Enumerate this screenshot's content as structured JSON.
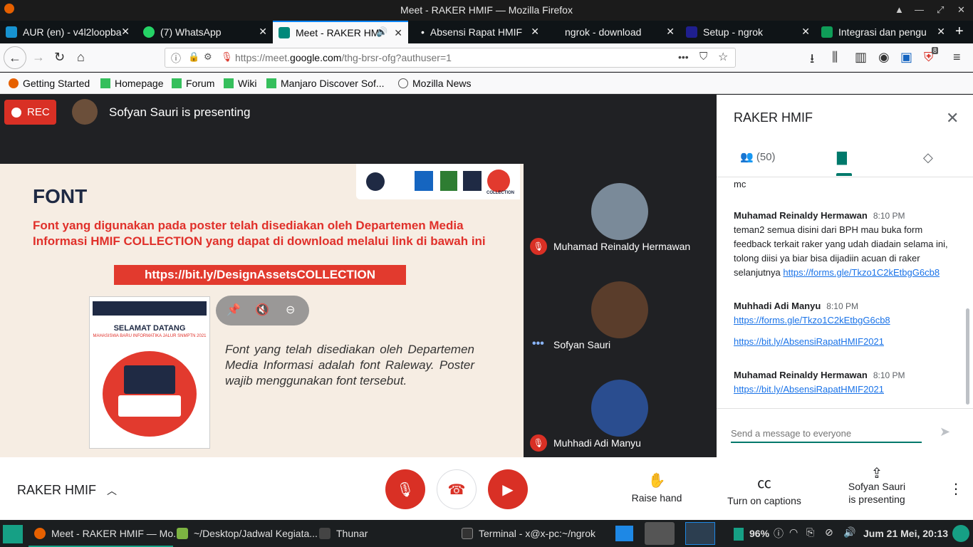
{
  "window": {
    "title": "Meet - RAKER HMIF — Mozilla Firefox"
  },
  "tabs": [
    {
      "label": "AUR (en) - v4l2loopba",
      "icon_color": "#1793d1"
    },
    {
      "label": "(7) WhatsApp",
      "icon_color": "#25d366"
    },
    {
      "label": "Meet - RAKER HMI",
      "icon_color": "#00897b",
      "active": true
    },
    {
      "label": "Absensi Rapat HMIF",
      "icon_color": "#fff"
    },
    {
      "label": "ngrok - download",
      "icon_color": "#444"
    },
    {
      "label": "Setup - ngrok",
      "icon_color": "#1f1f8f"
    },
    {
      "label": "Integrasi dan pengu",
      "icon_color": "#0f9d58"
    }
  ],
  "nav": {
    "url_prefix": "https://meet.",
    "url_domain": "google.com",
    "url_path": "/thg-brsr-ofg?authuser=1",
    "more_label": "•••",
    "badge_count": "8"
  },
  "bookmarks": [
    {
      "label": "Getting Started",
      "icon": "firefox-icon"
    },
    {
      "label": "Homepage",
      "icon": "manjaro-icon"
    },
    {
      "label": "Forum",
      "icon": "manjaro-icon"
    },
    {
      "label": "Wiki",
      "icon": "manjaro-icon"
    },
    {
      "label": "Manjaro Discover Sof...",
      "icon": "manjaro-icon"
    },
    {
      "label": "Mozilla News",
      "icon": "globe-icon"
    }
  ],
  "meet": {
    "rec_label": "REC",
    "presenting_label": "Sofyan Sauri is presenting",
    "slide": {
      "title": "FONT",
      "body": "Font yang digunakan pada poster telah disediakan oleh Departemen Media Informasi HMIF COLLECTION yang dapat di download melalui link di bawah ini",
      "link": "https://bit.ly/DesignAssetsCOLLECTION",
      "poster_title": "SELAMAT DATANG",
      "poster_subtitle": "MAHASISWA BARU INFORMATIKA JALUR SNMPTN 2021",
      "description": "Font yang telah disediakan oleh Departemen Media Informasi adalah font Raleway. Poster wajib menggunakan font tersebut.",
      "logo_collection": "COLLECTION"
    },
    "participants": [
      {
        "name": "Muhamad Reinaldy Hermawan",
        "muted": true,
        "avatar_color": "#7a8a99"
      },
      {
        "name": "Sofyan Sauri",
        "muted": false,
        "avatar_color": "#5a3d2b"
      },
      {
        "name": "Muhhadi Adi Manyu",
        "muted": true,
        "avatar_color": "#2a4d8f"
      }
    ]
  },
  "panel": {
    "title": "RAKER HMIF",
    "people_count": "(50)",
    "messages": [
      {
        "sender": "",
        "time": "",
        "lines": [
          "mc"
        ],
        "links": []
      },
      {
        "sender": "Muhamad Reinaldy Hermawan",
        "time": "8:10 PM",
        "lines": [
          "teman2 semua disini dari BPH mau buka form feedback terkait raker yang udah diadain selama ini, tolong diisi ya biar bisa dijadiin acuan di raker selanjutnya"
        ],
        "links": [
          "https://forms.gle/Tkzo1C2kEtbgG6cb8"
        ]
      },
      {
        "sender": "Muhhadi Adi Manyu",
        "time": "8:10 PM",
        "lines": [],
        "links": [
          "https://forms.gle/Tkzo1C2kEtbgG6cb8",
          "https://bit.ly/AbsensiRapatHMIF2021"
        ]
      },
      {
        "sender": "Muhamad Reinaldy Hermawan",
        "time": "8:10 PM",
        "lines": [],
        "links": [
          "https://bit.ly/AbsensiRapatHMIF2021"
        ]
      }
    ],
    "composer_placeholder": "Send a message to everyone"
  },
  "bottom": {
    "meeting_name": "RAKER HMIF",
    "raise_hand": "Raise hand",
    "captions": "Turn on captions",
    "presenting_line1": "Sofyan Sauri",
    "presenting_line2": "is presenting"
  },
  "taskbar": {
    "items": [
      {
        "label": "Meet - RAKER HMIF — Mo..."
      },
      {
        "label": "~/Desktop/Jadwal Kegiata..."
      },
      {
        "label": "Thunar"
      },
      {
        "label": "Terminal - x@x-pc:~/ngrok"
      }
    ],
    "battery": "96%",
    "datetime": "Jum 21 Mei, 20:13"
  },
  "colors": {
    "accent": "#00796b",
    "danger": "#d93025",
    "link": "#1a73e8"
  }
}
